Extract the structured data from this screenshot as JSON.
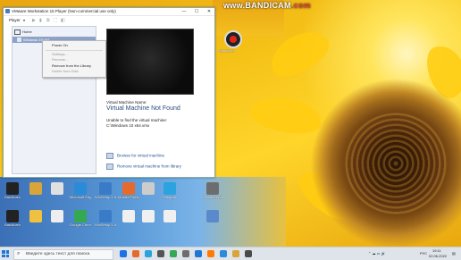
{
  "window": {
    "title": "VMware Workstation 15 Player (Non-commercial use only)",
    "controls": {
      "minimize": "—",
      "maximize": "☐",
      "close": "✕"
    }
  },
  "toolbar": {
    "player_label": "Player",
    "dropdown_glyph": "▾"
  },
  "library": {
    "home_label": "Home",
    "vm_item_label": "Windows 10 x64"
  },
  "context_menu": {
    "items": [
      {
        "label": "Power On",
        "enabled": true
      },
      {
        "label": "Settings...",
        "enabled": false
      },
      {
        "label": "Rename...",
        "enabled": false
      },
      {
        "label": "Remove from the Library",
        "enabled": true
      },
      {
        "label": "Delete from Disk",
        "enabled": false
      }
    ]
  },
  "details": {
    "name_label": "Virtual Machine Name:",
    "vm_name": "Virtual Machine Not Found",
    "error_line1": "Unable to find the virtual machine:",
    "error_line2": "C:\\Windows 10 x64.vmx",
    "browse_action": "Browse for virtual machine",
    "remove_action": "Remove virtual machine from library"
  },
  "overlay": {
    "bandicam_prefix": "www.",
    "bandicam_brand": "BANDICAM",
    "bandicam_suffix": ".com"
  },
  "desktop": {
    "right_icon_label": "Bandicam",
    "row1": [
      {
        "label": "Bandicam",
        "color": "#222222"
      },
      {
        "label": "",
        "color": "#d9a43a"
      },
      {
        "label": "",
        "color": "#e0e0e0"
      },
      {
        "label": "Microsoft Edge",
        "color": "#2b8bd6"
      },
      {
        "label": "WinSetup 1.6.2",
        "color": "#3a7bc8"
      },
      {
        "label": "Mozilla Firefox",
        "color": "#e66a2c"
      },
      {
        "label": "",
        "color": "#cccccc"
      },
      {
        "label": "Telegram",
        "color": "#2aa3de"
      },
      {
        "label": "VMware Workstation",
        "color": "#6d6d6d"
      }
    ],
    "row2": [
      {
        "label": "Bandicam",
        "color": "#222222"
      },
      {
        "label": "",
        "color": "#f0c040"
      },
      {
        "label": "",
        "color": "#eeeeee"
      },
      {
        "label": "Google Chrome",
        "color": "#34a853"
      },
      {
        "label": "WinSetup 1.6.2",
        "color": "#3a7bc8"
      },
      {
        "label": "",
        "color": "#f0f0f0"
      },
      {
        "label": "",
        "color": "#f0f0f0"
      },
      {
        "label": "",
        "color": "#f0f0f0"
      },
      {
        "label": "",
        "color": "#5a8acb"
      }
    ]
  },
  "taskbar": {
    "search_placeholder": "Введите здесь текст для поиска",
    "tray_language": "РУС",
    "time": "19:11",
    "date": "02.06.2022",
    "apps": [
      "#1a73e8",
      "#e66a2c",
      "#2aa3de",
      "#555555",
      "#34a853",
      "#6d6d6d",
      "#1c78d6",
      "#ff7a00",
      "#2b8bd6",
      "#d9a43a",
      "#4a4a4a"
    ]
  }
}
